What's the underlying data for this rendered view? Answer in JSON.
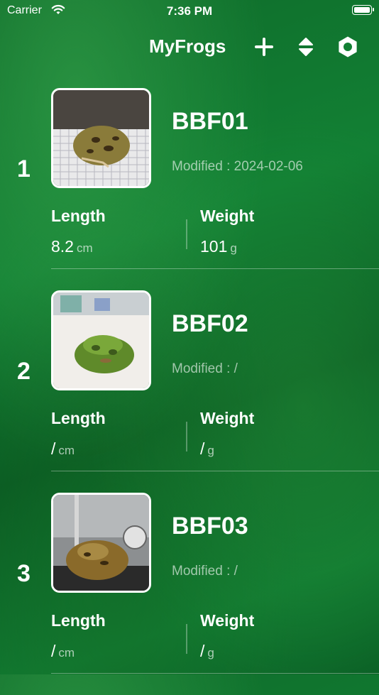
{
  "status_bar": {
    "carrier": "Carrier",
    "time": "7:36 PM"
  },
  "nav": {
    "title": "MyFrogs",
    "add_icon": "plus-icon",
    "sort_icon": "sort-icon",
    "settings_icon": "gear-icon"
  },
  "labels": {
    "length": "Length",
    "weight": "Weight",
    "length_unit": "cm",
    "weight_unit": "g"
  },
  "frogs": [
    {
      "index": "1",
      "name": "BBF01",
      "modified": "Modified : 2024-02-06",
      "length": "8.2",
      "weight": "101"
    },
    {
      "index": "2",
      "name": "BBF02",
      "modified": "Modified : /",
      "length": "/",
      "weight": "/"
    },
    {
      "index": "3",
      "name": "BBF03",
      "modified": "Modified : /",
      "length": "/",
      "weight": "/"
    }
  ],
  "colors": {
    "background": "#0f6b2a",
    "text": "#ffffff"
  }
}
